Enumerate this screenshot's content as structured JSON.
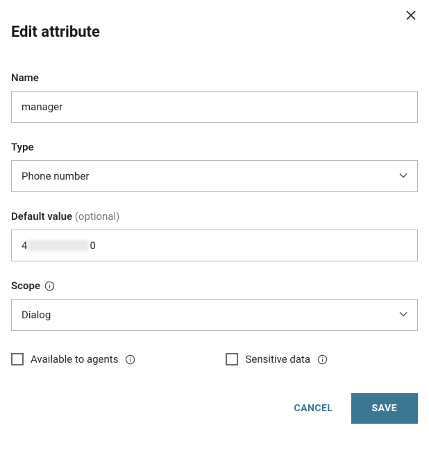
{
  "dialog": {
    "title": "Edit attribute"
  },
  "fields": {
    "name": {
      "label": "Name",
      "value": "manager"
    },
    "type": {
      "label": "Type",
      "value": "Phone number"
    },
    "default_value": {
      "label": "Default value ",
      "optional_text": "(optional)",
      "prefix": "4",
      "suffix": "0"
    },
    "scope": {
      "label": "Scope",
      "value": "Dialog"
    }
  },
  "checkboxes": {
    "available_to_agents": {
      "label": "Available to agents",
      "checked": false
    },
    "sensitive_data": {
      "label": "Sensitive data",
      "checked": false
    }
  },
  "buttons": {
    "cancel": "CANCEL",
    "save": "SAVE"
  }
}
